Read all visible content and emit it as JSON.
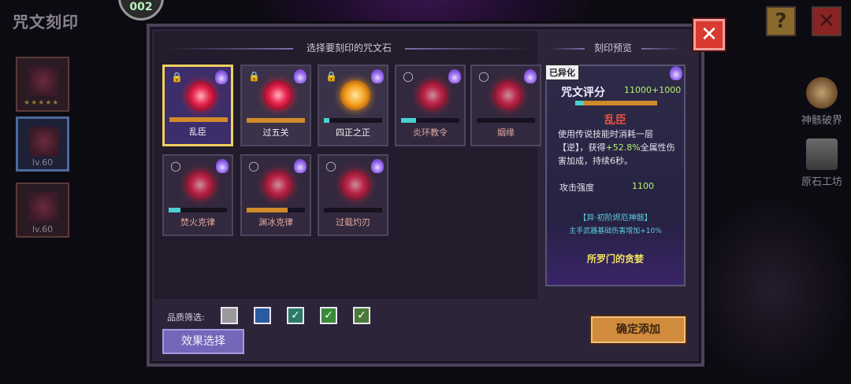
{
  "page": {
    "title": "咒文刻印",
    "top_badge": "002"
  },
  "side_cards": [
    {
      "level": "",
      "stars": "★★★★★"
    },
    {
      "level": "lv.60",
      "stars": ""
    },
    {
      "level": "lv.60",
      "stars": ""
    }
  ],
  "right_nav": [
    {
      "label": "神骸破界"
    },
    {
      "label": "原石工坊"
    }
  ],
  "corner": {
    "help": "?",
    "close": "✕"
  },
  "panel": {
    "close": "✕",
    "select_header": "选择要刻印的咒文石",
    "preview_header": "刻印预览"
  },
  "runes": [
    {
      "name": "乱臣",
      "fill_pct": 100,
      "color": "#d08a2a",
      "gem": "red",
      "lock": true,
      "state": "selected"
    },
    {
      "name": "过五关",
      "fill_pct": 100,
      "color": "#d08a2a",
      "gem": "red",
      "lock": true,
      "state": "normal"
    },
    {
      "name": "四正之正",
      "fill_pct": 10,
      "color": "#4ad0d0",
      "gem": "orange",
      "lock": true,
      "state": "normal"
    },
    {
      "name": "炎环教令",
      "fill_pct": 25,
      "color": "#4ad0d0",
      "gem": "red",
      "lock": false,
      "state": "dim"
    },
    {
      "name": "姻缘",
      "fill_pct": 0,
      "color": "#4ad0d0",
      "gem": "red",
      "lock": false,
      "state": "dim"
    },
    {
      "name": "焚火克律",
      "fill_pct": 20,
      "color": "#4ad0d0",
      "gem": "red",
      "lock": false,
      "state": "dim"
    },
    {
      "name": "渊冰克律",
      "fill_pct": 70,
      "color": "#d08a2a",
      "gem": "red",
      "lock": false,
      "state": "dim"
    },
    {
      "name": "过载灼刃",
      "fill_pct": 0,
      "color": "#4ad0d0",
      "gem": "red",
      "lock": false,
      "state": "dim"
    }
  ],
  "preview": {
    "tag": "已异化",
    "score_label": "咒文评分",
    "score_value": "11000+1000",
    "score_progress": 1.0,
    "rune_title": "乱臣",
    "desc_before": "使用传说技能时消耗一层【逆】，获得",
    "desc_highlight": "+52.8%",
    "desc_after": "全属性伤害加成，持续6秒。",
    "stat_label": "攻击强度",
    "stat_value": "1100",
    "effect_name": "【异·初阶烬厄神骸】",
    "effect_desc": "主手武器基础伤害增加+10%",
    "set_name": "所罗门的贪婪"
  },
  "filter": {
    "label": "品质筛选:",
    "options": [
      {
        "color": "#9a9a9a",
        "checked": false
      },
      {
        "color": "#2a5aa0",
        "checked": false
      },
      {
        "color": "#2a7a6a",
        "checked": true
      },
      {
        "color": "#3a8a3a",
        "checked": true
      },
      {
        "color": "#4a7a3a",
        "checked": true
      }
    ]
  },
  "buttons": {
    "effect": "效果选择",
    "confirm": "确定添加"
  }
}
